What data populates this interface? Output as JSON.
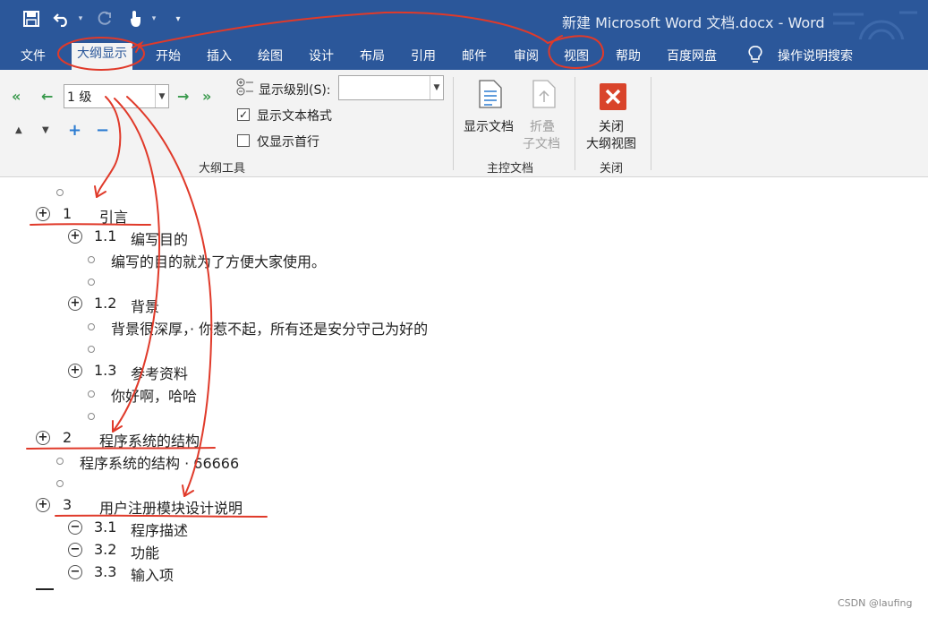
{
  "window": {
    "title": "新建 Microsoft Word 文档.docx  -  Word"
  },
  "qat": {
    "save": "save-icon",
    "undo": "undo-icon",
    "redo": "redo-icon",
    "touch": "touch-mode-icon",
    "customize": "customize-icon"
  },
  "tabs": [
    "文件",
    "大纲显示",
    "开始",
    "插入",
    "绘图",
    "设计",
    "布局",
    "引用",
    "邮件",
    "审阅",
    "视图",
    "帮助",
    "百度网盘"
  ],
  "tell_me": "操作说明搜索",
  "ribbon": {
    "level_value": "1 级",
    "show_level_label": "显示级别(S):",
    "show_level_value": "",
    "show_text_format_label": "显示文本格式",
    "show_text_format_checked": true,
    "show_first_line_label": "仅显示首行",
    "show_first_line_checked": false,
    "outline_tools_label": "大纲工具",
    "show_document_label": "显示文档",
    "collapse_sub_line1": "折叠",
    "collapse_sub_line2": "子文档",
    "master_doc_label": "主控文档",
    "close_outline_line1": "关闭",
    "close_outline_line2": "大纲视图",
    "close_group_label": "关闭"
  },
  "outline": [
    {
      "type": "empty",
      "level": 1
    },
    {
      "type": "heading",
      "level": 0,
      "num": "1",
      "text": "引言",
      "marker": "plus"
    },
    {
      "type": "heading",
      "level": 1,
      "num": "1.1",
      "text": "编写目的",
      "marker": "plus"
    },
    {
      "type": "body",
      "level": 2,
      "text": "编写的目的就为了方便大家使用。"
    },
    {
      "type": "empty",
      "level": 2
    },
    {
      "type": "heading",
      "level": 1,
      "num": "1.2",
      "text": "背景",
      "marker": "plus"
    },
    {
      "type": "body",
      "level": 2,
      "text": "背景很深厚，· 你惹不起，所有还是安分守己为好的"
    },
    {
      "type": "empty",
      "level": 2
    },
    {
      "type": "heading",
      "level": 1,
      "num": "1.3",
      "text": "参考资料",
      "marker": "plus"
    },
    {
      "type": "body",
      "level": 2,
      "text": "你好啊，哈哈"
    },
    {
      "type": "empty",
      "level": 2
    },
    {
      "type": "heading",
      "level": 0,
      "num": "2",
      "text": "程序系统的结构",
      "marker": "plus"
    },
    {
      "type": "body",
      "level": 1,
      "text": "程序系统的结构    · 66666"
    },
    {
      "type": "empty",
      "level": 1
    },
    {
      "type": "heading",
      "level": 0,
      "num": "3",
      "text": "用户注册模块设计说明",
      "marker": "plus"
    },
    {
      "type": "heading",
      "level": 1,
      "num": "3.1",
      "text": "程序描述",
      "marker": "minus"
    },
    {
      "type": "heading",
      "level": 1,
      "num": "3.2",
      "text": "功能",
      "marker": "minus"
    },
    {
      "type": "heading",
      "level": 1,
      "num": "3.3",
      "text": "输入项",
      "marker": "minus"
    }
  ],
  "watermark": "CSDN @laufing",
  "colors": {
    "titlebar": "#2b579a",
    "ribbon": "#f3f3f3",
    "annotation": "#e03a2a",
    "close_icon": "#d9442b"
  }
}
